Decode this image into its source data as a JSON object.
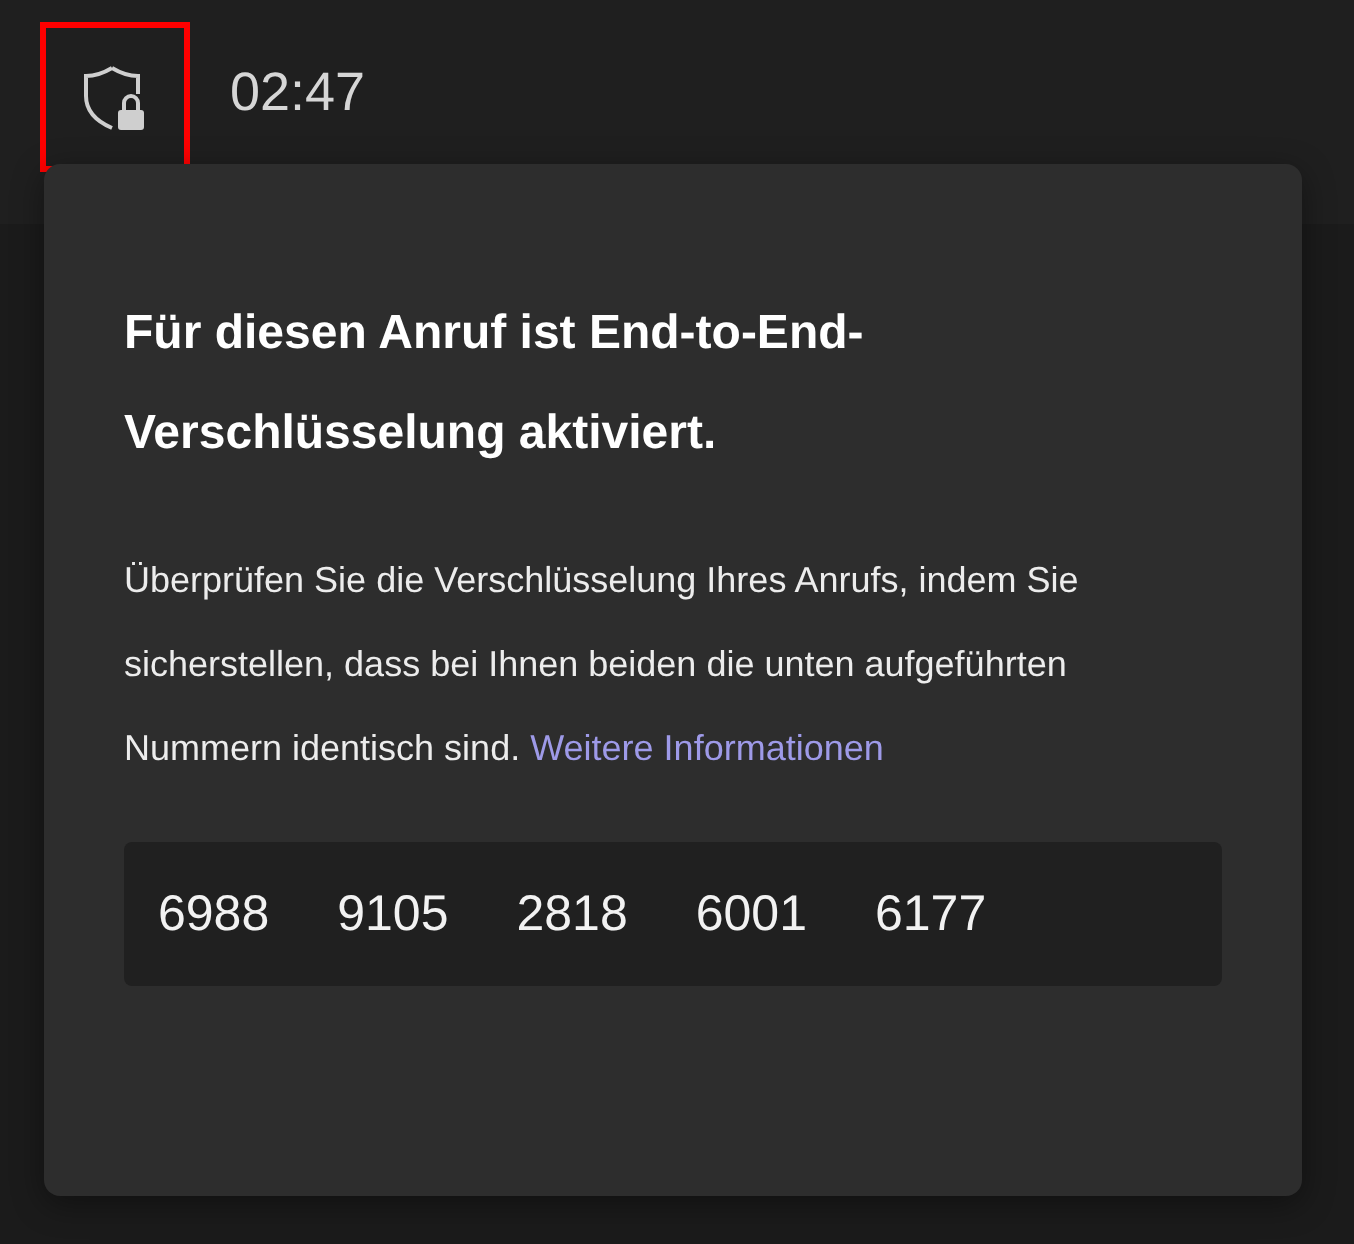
{
  "header": {
    "shield_button": {
      "highlighted": true
    },
    "call_time": "02:47"
  },
  "popup": {
    "title": "Für diesen Anruf ist End-to-End-Verschlüsselung aktiviert.",
    "description": "Überprüfen Sie die Verschlüsselung Ihres Anrufs, indem Sie sicherstellen, dass bei Ihnen beiden die unten aufgeführten Nummern identisch sind.",
    "link": "Weitere Informationen",
    "codes": [
      "6988",
      "9105",
      "2818",
      "6001",
      "6177"
    ]
  }
}
